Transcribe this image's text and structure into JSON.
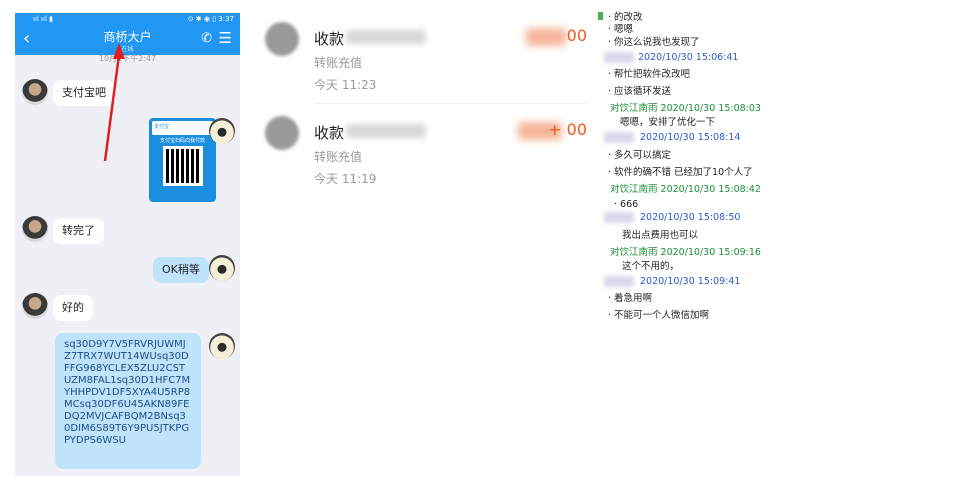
{
  "chat": {
    "status_left": "ııl ııl ▮",
    "status_right": "⊙ ✱ ◉ ▯ 3:37",
    "back_label": "‹",
    "title": "商桥大户",
    "subtitle": "在线",
    "timestamp": "10月1下午2:47",
    "messages": [
      {
        "text": "支付宝吧"
      },
      {
        "text": "转完了"
      },
      {
        "text": "OK稍等"
      },
      {
        "text": "好的"
      },
      {
        "text": "sq30D9Y7V5FRVRJUWMJZ7TRX7WUT14WUsq30DFFG968YCLEX5ZLU2CSTUZM8FAL1sq30D1HFC7MYHHPDV1DF5XYA4U5RP8MCsq30DF6U45AKN89FEDQ2MVJCAFBQM2BNsq30DIM6S89T6Y9PU5JTKPGPYDPS6WSU"
      }
    ],
    "qr_header": "支付宝",
    "qr_label": "支付宝扫码向我付款"
  },
  "transactions": [
    {
      "title": "收款",
      "amount": "00",
      "desc": "转账充值",
      "time": "今天 11:23"
    },
    {
      "title": "收款",
      "amount": "+ 00",
      "desc": "转账充值",
      "time": "今天 11:19"
    }
  ],
  "log": [
    {
      "text": "· 的改改",
      "kind": "msg"
    },
    {
      "text": "· 嗯嗯",
      "kind": "msg"
    },
    {
      "text": "· 你这么说我也发现了",
      "kind": "msg"
    },
    {
      "text": "2020/10/30 15:06:41",
      "kind": "header-blue"
    },
    {
      "text": "· 帮忙把软件改改吧",
      "kind": "msg"
    },
    {
      "text": "· 应该循环发送",
      "kind": "msg"
    },
    {
      "text": "对饮江南雨 2020/10/30 15:08:03",
      "kind": "header"
    },
    {
      "text": "嗯嗯，安排了优化一下",
      "kind": "msg"
    },
    {
      "text": "2020/10/30 15:08:14",
      "kind": "header-blue"
    },
    {
      "text": "· 多久可以搞定",
      "kind": "msg"
    },
    {
      "text": "· 软件的确不错 已经加了10个人了",
      "kind": "msg"
    },
    {
      "text": "对饮江南雨 2020/10/30 15:08:42",
      "kind": "header"
    },
    {
      "text": "· 666",
      "kind": "msg"
    },
    {
      "text": "2020/10/30 15:08:50",
      "kind": "header-blue"
    },
    {
      "text": "我出点费用也可以",
      "kind": "msg"
    },
    {
      "text": "对饮江南雨 2020/10/30 15:09:16",
      "kind": "header"
    },
    {
      "text": "这个不用的，",
      "kind": "msg"
    },
    {
      "text": "2020/10/30 15:09:41",
      "kind": "header-blue"
    },
    {
      "text": "· 着急用啊",
      "kind": "msg"
    },
    {
      "text": "· 不能可一个人微信加啊",
      "kind": "msg"
    }
  ]
}
